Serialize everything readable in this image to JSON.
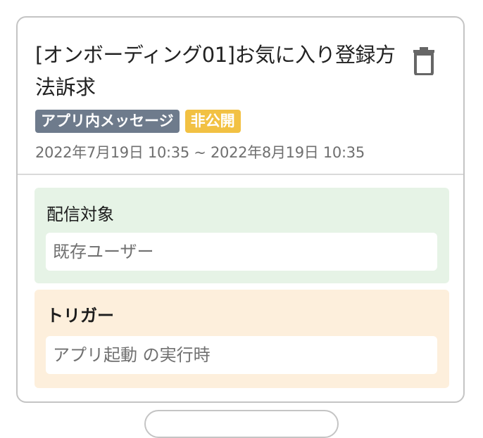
{
  "campaign": {
    "title": "[オンボーディング01]お気に入り登録方法訴求",
    "badges": {
      "type": "アプリ内メッセージ",
      "visibility": "非公開"
    },
    "period": "2022年7月19日 10:35 ~ 2022年8月19日 10:35",
    "target": {
      "label": "配信対象",
      "value": "既存ユーザー"
    },
    "trigger": {
      "label": "トリガー",
      "value": "アプリ起動 の実行時"
    }
  },
  "icons": {
    "delete": "trash-icon"
  },
  "colors": {
    "badge_type": "#6e7b8c",
    "badge_visibility": "#f2c143",
    "target_bg": "#e6f3e6",
    "trigger_bg": "#fdefdc",
    "border": "#c4c4c4"
  }
}
